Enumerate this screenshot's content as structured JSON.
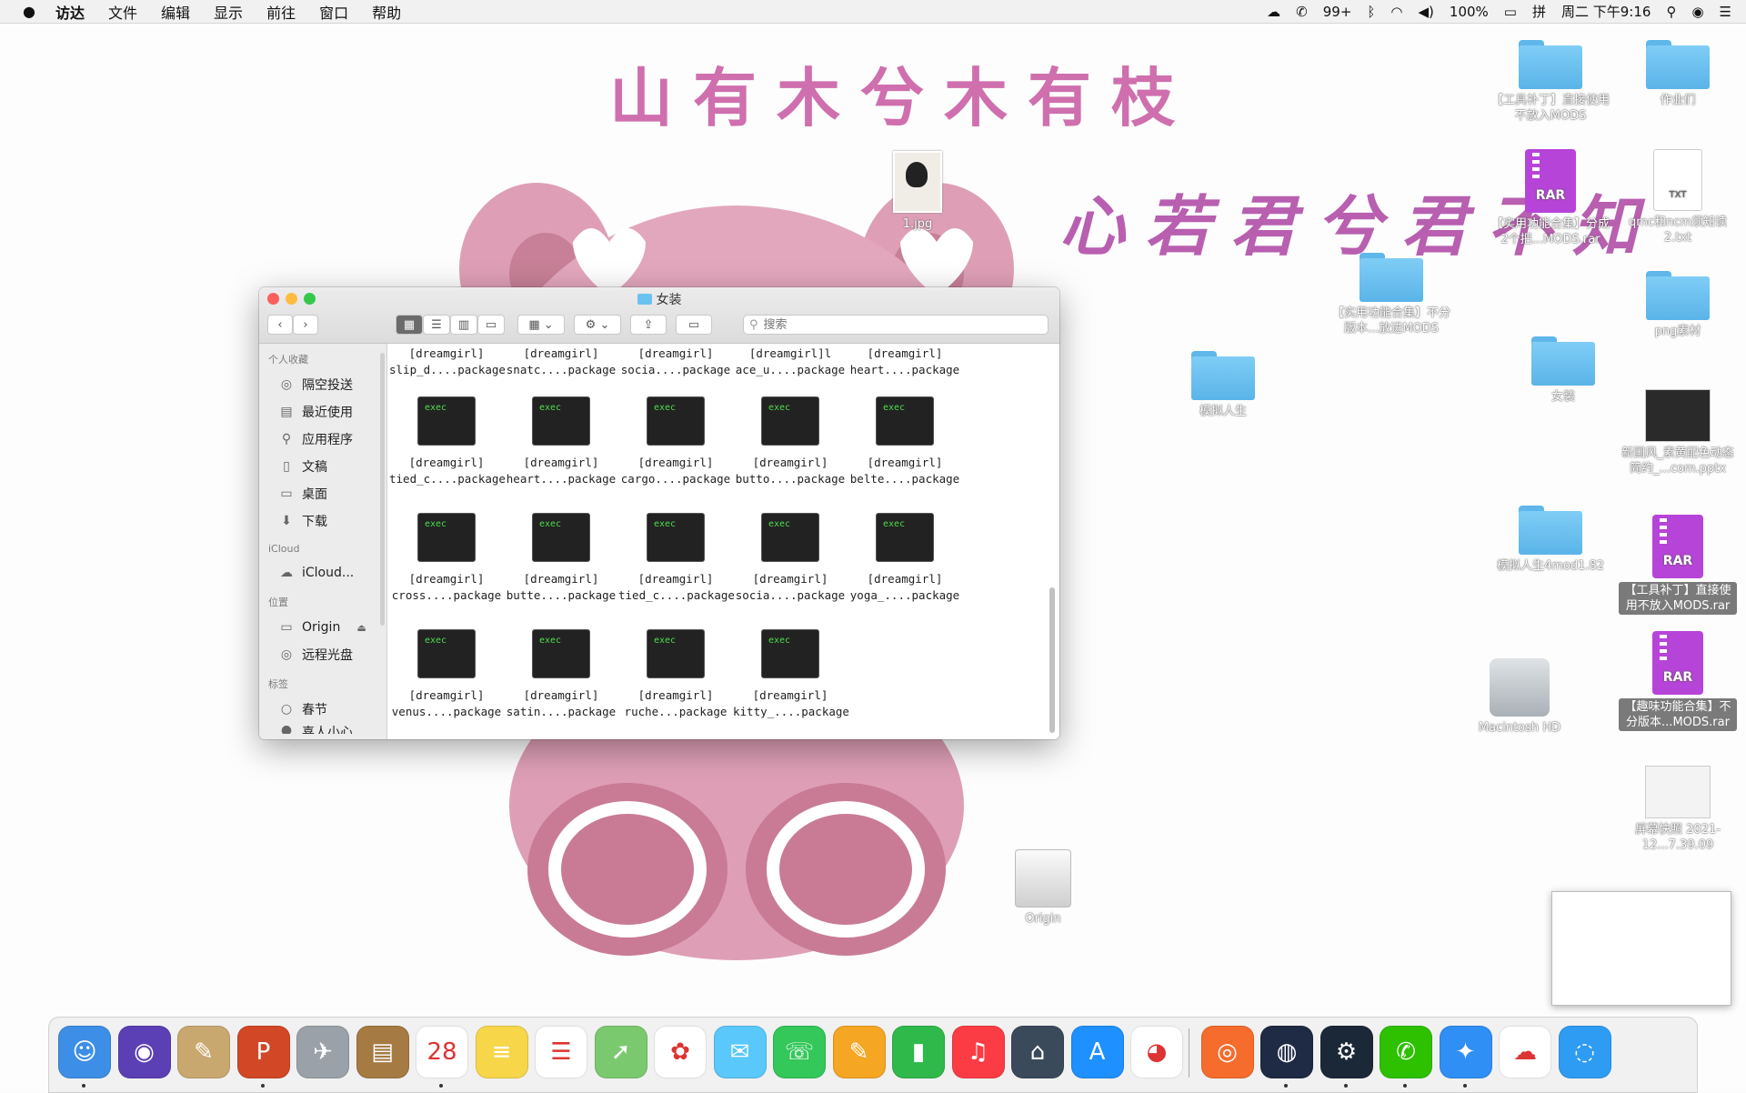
{
  "menubar": {
    "apple_icon": "apple-icon",
    "items": [
      "访达",
      "文件",
      "编辑",
      "显示",
      "前往",
      "窗口",
      "帮助"
    ],
    "status": {
      "wechat_badge": "99+",
      "battery": "100%",
      "clock": "周二 下午9:16"
    }
  },
  "wallpaper": {
    "line1": "山有木兮木有枝",
    "line2": "心若君兮君不知",
    "colors": {
      "text": "#cf6fae",
      "bear": "#de9fb6"
    }
  },
  "desktop_icons": [
    {
      "type": "photo",
      "label": "1.jpg"
    },
    {
      "type": "folder",
      "label": "【工具补丁】直接使用不放入MODS"
    },
    {
      "type": "folder",
      "label": "作业们"
    },
    {
      "type": "rar",
      "badge": "RAR",
      "label": "【实用功能合集】分成2个把...MODS.rar"
    },
    {
      "type": "txt",
      "badge": "TXT",
      "label": "qmc和ncm须知读2.txt"
    },
    {
      "type": "folder",
      "label": "【实用功能合集】不分版本...放进MODS"
    },
    {
      "type": "folder",
      "label": "png素材"
    },
    {
      "type": "folder",
      "label": "模拟人生"
    },
    {
      "type": "folder",
      "label": "女装"
    },
    {
      "type": "pptx",
      "label": "新国风_素黄配色动态简约_...com.pptx"
    },
    {
      "type": "folder",
      "label": "模拟人生4mod1.82"
    },
    {
      "type": "rar",
      "badge": "RAR",
      "label": "【工具补丁】直接使用不放入MODS.rar"
    },
    {
      "type": "hdd",
      "label": "Macintosh HD"
    },
    {
      "type": "rar",
      "badge": "RAR",
      "label": "【趣味功能合集】不分版本...MODS.rar"
    },
    {
      "type": "disk",
      "label": "Origin"
    },
    {
      "type": "screenshot",
      "label": "屏幕快照 2021-12...7.39.09"
    }
  ],
  "finder": {
    "title": "女装",
    "search_placeholder": "搜索",
    "sidebar": {
      "favorites_header": "个人收藏",
      "favorites": [
        {
          "icon": "airdrop-icon",
          "glyph": "◎",
          "label": "隔空投送"
        },
        {
          "icon": "recents-icon",
          "glyph": "▤",
          "label": "最近使用"
        },
        {
          "icon": "applications-icon",
          "glyph": "⚲",
          "label": "应用程序"
        },
        {
          "icon": "documents-icon",
          "glyph": "▯",
          "label": "文稿"
        },
        {
          "icon": "desktop-icon",
          "glyph": "▭",
          "label": "桌面"
        },
        {
          "icon": "downloads-icon",
          "glyph": "⬇",
          "label": "下载"
        }
      ],
      "icloud_header": "iCloud",
      "icloud": [
        {
          "icon": "cloud-icon",
          "glyph": "☁",
          "label": "iCloud..."
        }
      ],
      "locations_header": "位置",
      "locations": [
        {
          "icon": "disk-icon",
          "glyph": "▭",
          "label": "Origin",
          "eject": "⏏"
        },
        {
          "icon": "remote-disc-icon",
          "glyph": "◎",
          "label": "远程光盘"
        }
      ],
      "tags_header": "标签",
      "tags": [
        {
          "icon": "tag-icon",
          "glyph": "○",
          "label": "春节"
        }
      ],
      "tags_partial": "喜人小心"
    },
    "exec_badge": "exec",
    "top_row": [
      {
        "line1": "[dreamgirl]",
        "line2": "slip_d....package"
      },
      {
        "line1": "[dreamgirl]",
        "line2": "snatc....package"
      },
      {
        "line1": "[dreamgirl]",
        "line2": "socia....package"
      },
      {
        "line1": "[dreamgirl]l",
        "line2": "ace_u....package"
      },
      {
        "line1": "[dreamgirl]",
        "line2": "heart....package"
      }
    ],
    "rows": [
      [
        {
          "line1": "[dreamgirl]",
          "line2": "tied_c....package"
        },
        {
          "line1": "[dreamgirl]",
          "line2": "heart....package"
        },
        {
          "line1": "[dreamgirl]",
          "line2": "cargo....package"
        },
        {
          "line1": "[dreamgirl]",
          "line2": "butto....package"
        },
        {
          "line1": "[dreamgirl]",
          "line2": "belte....package"
        }
      ],
      [
        {
          "line1": "[dreamgirl]",
          "line2": "cross....package"
        },
        {
          "line1": "[dreamgirl]",
          "line2": "butte....package"
        },
        {
          "line1": "[dreamgirl]",
          "line2": "tied_c....package"
        },
        {
          "line1": "[dreamgirl]",
          "line2": "socia....package"
        },
        {
          "line1": "[dreamgirl]",
          "line2": "yoga_....package"
        }
      ],
      [
        {
          "line1": "[dreamgirl]",
          "line2": "venus....package"
        },
        {
          "line1": "[dreamgirl]",
          "line2": "satin....package"
        },
        {
          "line1": "[dreamgirl]",
          "line2": "ruche...package"
        },
        {
          "line1": "[dreamgirl]",
          "line2": "kitty_....package"
        }
      ]
    ]
  },
  "dock": {
    "apps": [
      {
        "name": "finder-app",
        "color": "#3d8ee6",
        "glyph": "☺"
      },
      {
        "name": "siri-app",
        "color": "#5b3fb4",
        "glyph": "◉"
      },
      {
        "name": "preview-app",
        "color": "#c9a870",
        "glyph": "✎"
      },
      {
        "name": "powerpoint-app",
        "color": "#d24726",
        "glyph": "P"
      },
      {
        "name": "launchpad-app",
        "color": "#9aa1a8",
        "glyph": "✈"
      },
      {
        "name": "notebook-app",
        "color": "#a57a43",
        "glyph": "▤"
      },
      {
        "name": "calendar-app",
        "color": "#ffffff",
        "glyph": "28"
      },
      {
        "name": "notes-app",
        "color": "#f7d64a",
        "glyph": "≡"
      },
      {
        "name": "reminders-app",
        "color": "#ffffff",
        "glyph": "☰"
      },
      {
        "name": "maps-app",
        "color": "#7bc96f",
        "glyph": "➚"
      },
      {
        "name": "photos-app",
        "color": "#ffffff",
        "glyph": "✿"
      },
      {
        "name": "messages-app",
        "color": "#5ac8fa",
        "glyph": "✉"
      },
      {
        "name": "facetime-app",
        "color": "#34c759",
        "glyph": "☏"
      },
      {
        "name": "pages-app",
        "color": "#f5a623",
        "glyph": "✎"
      },
      {
        "name": "numbers-app",
        "color": "#2fb94a",
        "glyph": "▮"
      },
      {
        "name": "music-app",
        "color": "#fc3c44",
        "glyph": "♫"
      },
      {
        "name": "house-flipper-app",
        "color": "#3a4a5a",
        "glyph": "⌂"
      },
      {
        "name": "app-store-app",
        "color": "#1e90ff",
        "glyph": "A"
      },
      {
        "name": "qq-app",
        "color": "#ffffff",
        "glyph": "◕"
      },
      {
        "name": "origin-app",
        "color": "#f56c2d",
        "glyph": "◎"
      },
      {
        "name": "cloud-app",
        "color": "#1f2a44",
        "glyph": "◍"
      },
      {
        "name": "steam-app",
        "color": "#1b2838",
        "glyph": "⚙"
      },
      {
        "name": "wechat-app",
        "color": "#2dc100",
        "glyph": "✆"
      },
      {
        "name": "safari-app",
        "color": "#2f8ff5",
        "glyph": "✦"
      },
      {
        "name": "baidu-netdisk-app",
        "color": "#ffffff",
        "glyph": "☁"
      },
      {
        "name": "quick-look-app",
        "color": "#2f9cf4",
        "glyph": "◌"
      }
    ]
  }
}
